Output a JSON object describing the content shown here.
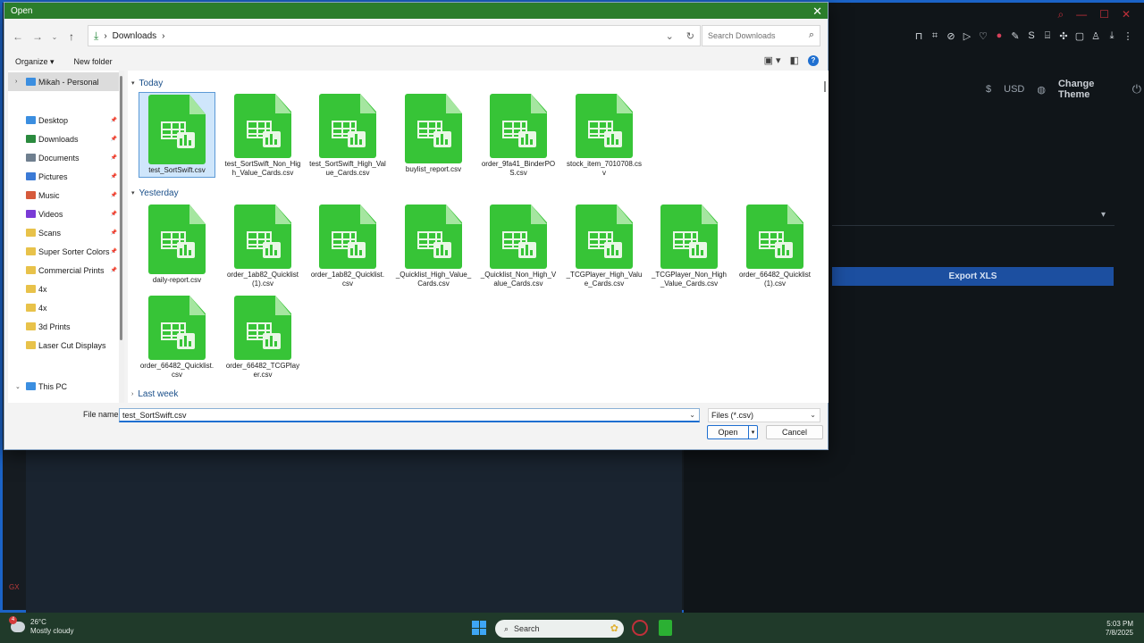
{
  "dialog": {
    "title": "Open",
    "breadcrumb": "Downloads",
    "search_placeholder": "Search Downloads",
    "toolbar": {
      "organize": "Organize ▾",
      "new_folder": "New folder"
    }
  },
  "nav": {
    "items": [
      {
        "label": "Mikah - Personal",
        "color": "#3b8ee0"
      },
      {
        "label": "Desktop",
        "color": "#3b8ee0"
      },
      {
        "label": "Downloads",
        "color": "#2a8a3e"
      },
      {
        "label": "Documents",
        "color": "#6f7f8f"
      },
      {
        "label": "Pictures",
        "color": "#3b7ad6"
      },
      {
        "label": "Music",
        "color": "#d65a3b"
      },
      {
        "label": "Videos",
        "color": "#7a3bd6"
      },
      {
        "label": "Scans",
        "color": "#e8c24a"
      },
      {
        "label": "Super Sorter Colors",
        "color": "#e8c24a"
      },
      {
        "label": "Commercial Prints",
        "color": "#e8c24a"
      },
      {
        "label": "4x",
        "color": "#e8c24a"
      },
      {
        "label": "4x",
        "color": "#e8c24a"
      },
      {
        "label": "3d Prints",
        "color": "#e8c24a"
      },
      {
        "label": "Laser Cut Displays",
        "color": "#e8c24a"
      },
      {
        "label": "This PC",
        "color": "#3b8ee0"
      }
    ]
  },
  "groups": {
    "today": "Today",
    "yesterday": "Yesterday",
    "last_week": "Last week"
  },
  "files": {
    "today": [
      "test_SortSwift.csv",
      "test_SortSwift_Non_High_Value_Cards.csv",
      "test_SortSwift_High_Value_Cards.csv",
      "buylist_report.csv",
      "order_9fa41_BinderPOS.csv",
      "stock_item_7010708.csv"
    ],
    "yesterday": [
      "daily-report.csv",
      "order_1ab82_Quicklist (1).csv",
      "order_1ab82_Quicklist.csv",
      "_Quicklist_High_Value_Cards.csv",
      "_Quicklist_Non_High_Value_Cards.csv",
      "_TCGPlayer_High_Value_Cards.csv",
      "_TCGPlayer_Non_High_Value_Cards.csv",
      "order_66482_Quicklist (1).csv",
      "order_66482_Quicklist.csv",
      "order_66482_TCGPlayer.csv"
    ]
  },
  "bottom": {
    "file_name_label": "File name:",
    "file_name_value": "test_SortSwift.csv",
    "filter": "Files (*.csv)",
    "open": "Open",
    "cancel": "Cancel"
  },
  "bg_app": {
    "currency": "USD",
    "change_theme": "Change Theme",
    "export": "Export XLS"
  },
  "taskbar": {
    "temp": "26°C",
    "weather": "Mostly cloudy",
    "search": "Search",
    "time": "5:03 PM",
    "date": "7/8/2025",
    "badge": "4"
  }
}
